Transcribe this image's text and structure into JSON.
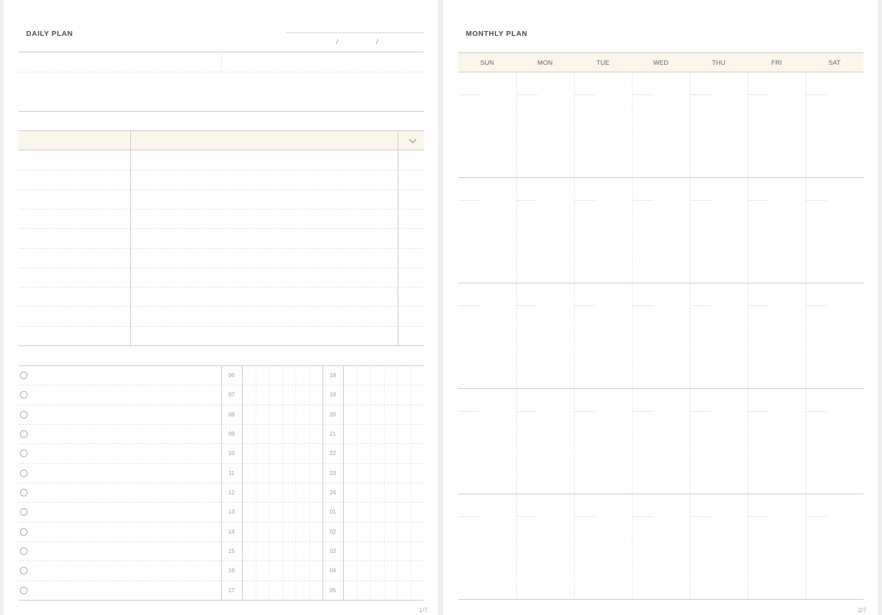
{
  "daily": {
    "title": "DAILY PLAN",
    "date_separator": "/",
    "page_number": "1/7",
    "hours_left": [
      "06",
      "07",
      "08",
      "09",
      "10",
      "11",
      "12",
      "13",
      "14",
      "15",
      "16",
      "17"
    ],
    "hours_right": [
      "18",
      "19",
      "20",
      "21",
      "22",
      "23",
      "24",
      "01",
      "02",
      "03",
      "04",
      "05"
    ],
    "task_table": {
      "check_icon": "checkmark-icon"
    },
    "todo_icon": "circle-checkbox-icon"
  },
  "monthly": {
    "title": "MONTHLY PLAN",
    "page_number": "2/7",
    "days": [
      "SUN",
      "MON",
      "TUE",
      "WED",
      "THU",
      "FRI",
      "SAT"
    ]
  },
  "colors": {
    "header_fill": "#faf6e9",
    "title_highlight": "#f6e6bd",
    "line": "#c9c9c9"
  }
}
